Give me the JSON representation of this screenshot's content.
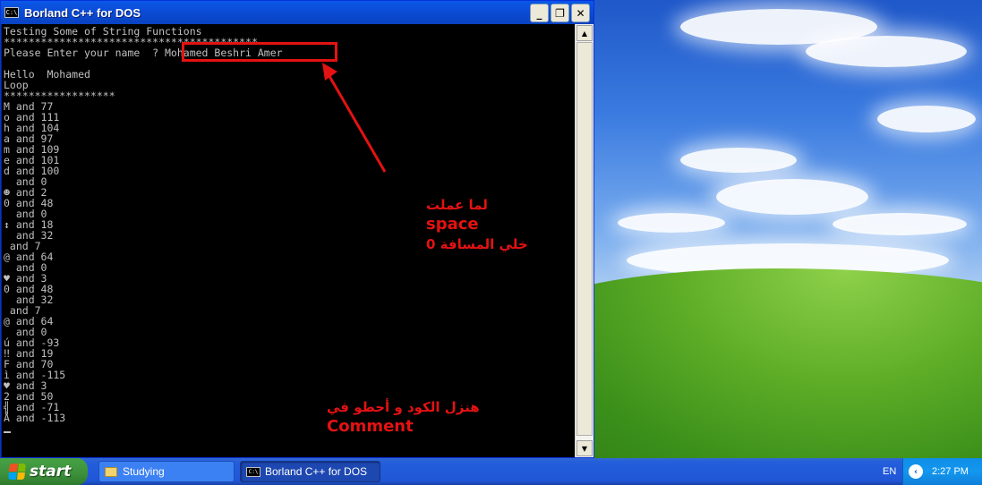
{
  "window": {
    "title": "Borland C++ for DOS",
    "icon_label": "C:\\",
    "buttons": {
      "minimize": "_",
      "restore": "❐",
      "close": "✕"
    }
  },
  "console": {
    "lines": [
      "Testing Some of String Functions",
      "*****************************************",
      "Please Enter your name  ? Mohamed Beshri Amer",
      "",
      "Hello  Mohamed",
      "Loop",
      "******************",
      "M and 77",
      "o and 111",
      "h and 104",
      "a and 97",
      "m and 109",
      "e and 101",
      "d and 100",
      "  and 0",
      "☻ and 2",
      "0 and 48",
      "  and 0",
      "↕ and 18",
      "  and 32",
      " and 7",
      "@ and 64",
      "  and 0",
      "♥ and 3",
      "0 and 48",
      "  and 32",
      " and 7",
      "@ and 64",
      "  and 0",
      "ú and -93",
      "‼ and 19",
      "F and 70",
      "ì and -115",
      "♥ and 3",
      "2 and 50",
      "╣ and -71",
      "Å and -113"
    ]
  },
  "annotations": {
    "top_note": [
      "لما عملت",
      "space",
      "خلي المسافة 0"
    ],
    "bottom_note": [
      "هنزل الكود و  أحطو في",
      "Comment"
    ]
  },
  "taskbar": {
    "start_label": "start",
    "tasks": [
      {
        "label": "Studying"
      },
      {
        "label": "Borland C++ for DOS"
      }
    ],
    "language": "EN",
    "time": "2:27 PM"
  },
  "colors": {
    "annotation": "#e41212",
    "console_text": "#c0c0c0",
    "titlebar": "#0b4dd8"
  }
}
